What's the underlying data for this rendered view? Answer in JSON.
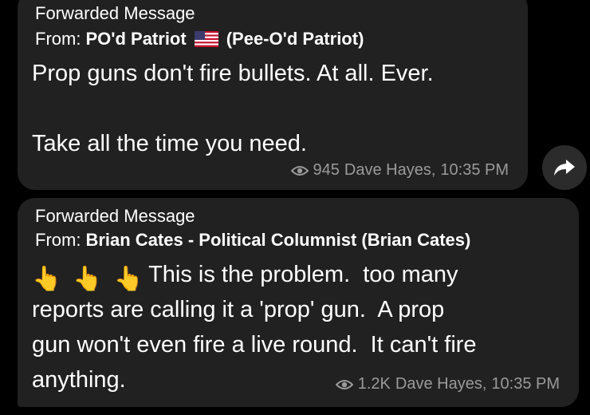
{
  "messages": [
    {
      "forward_label": "Forwarded Message",
      "from_label": "From:",
      "from_name": "PO'd Patriot",
      "from_flag_icon": "us-flag-icon",
      "from_alias": "(Pee-O'd Patriot)",
      "lines": [
        "Prop guns don't fire bullets. At all. Ever.",
        "",
        "Take all the time you need."
      ],
      "views": "945",
      "author": "Dave Hayes,",
      "time": "10:35 PM"
    },
    {
      "forward_label": "Forwarded Message",
      "from_label": "From:",
      "from_name": "Brian Cates - Political Columnist (Brian Cates)",
      "emoji": [
        "👆",
        "👆",
        "👆"
      ],
      "lines": [
        "This is the problem.  too many",
        "reports are calling it a 'prop' gun.  A prop",
        "gun won't even fire a live round.  It can't fire",
        "anything."
      ],
      "views": "1.2K",
      "author": "Dave Hayes,",
      "time": "10:35 PM"
    }
  ],
  "share_button": {
    "icon": "share-arrow-icon"
  },
  "colors": {
    "background": "#000000",
    "bubble": "#212121",
    "meta_text": "#9a9a9a",
    "text": "#ffffff"
  }
}
